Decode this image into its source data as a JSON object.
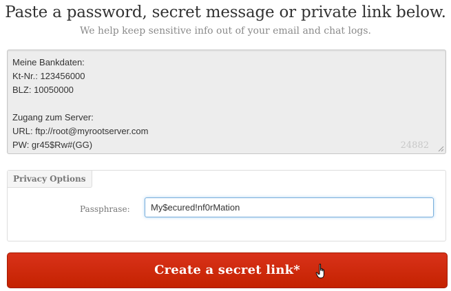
{
  "header": {
    "title": "Paste a password, secret message or private link below.",
    "subtitle": "We help keep sensitive info out of your email and chat logs."
  },
  "secret": {
    "text": "Meine Bankdaten:\nKt-Nr.: 123456000\nBLZ: 10050000\n\nZugang zum Server:\nURL: ftp://root@myrootserver.com\nPW: gr45$Rw#(GG)",
    "char_count": "24882"
  },
  "privacy": {
    "legend": "Privacy Options",
    "passphrase_label": "Passphrase:",
    "passphrase_value": "My$ecured!nf0rMation"
  },
  "actions": {
    "create_label": "Create a secret link*"
  },
  "colors": {
    "button": "#c42200",
    "focus": "#7aaedb"
  },
  "icons": {
    "cursor": "hand-pointer-icon",
    "resize": "resize-grip-icon"
  }
}
